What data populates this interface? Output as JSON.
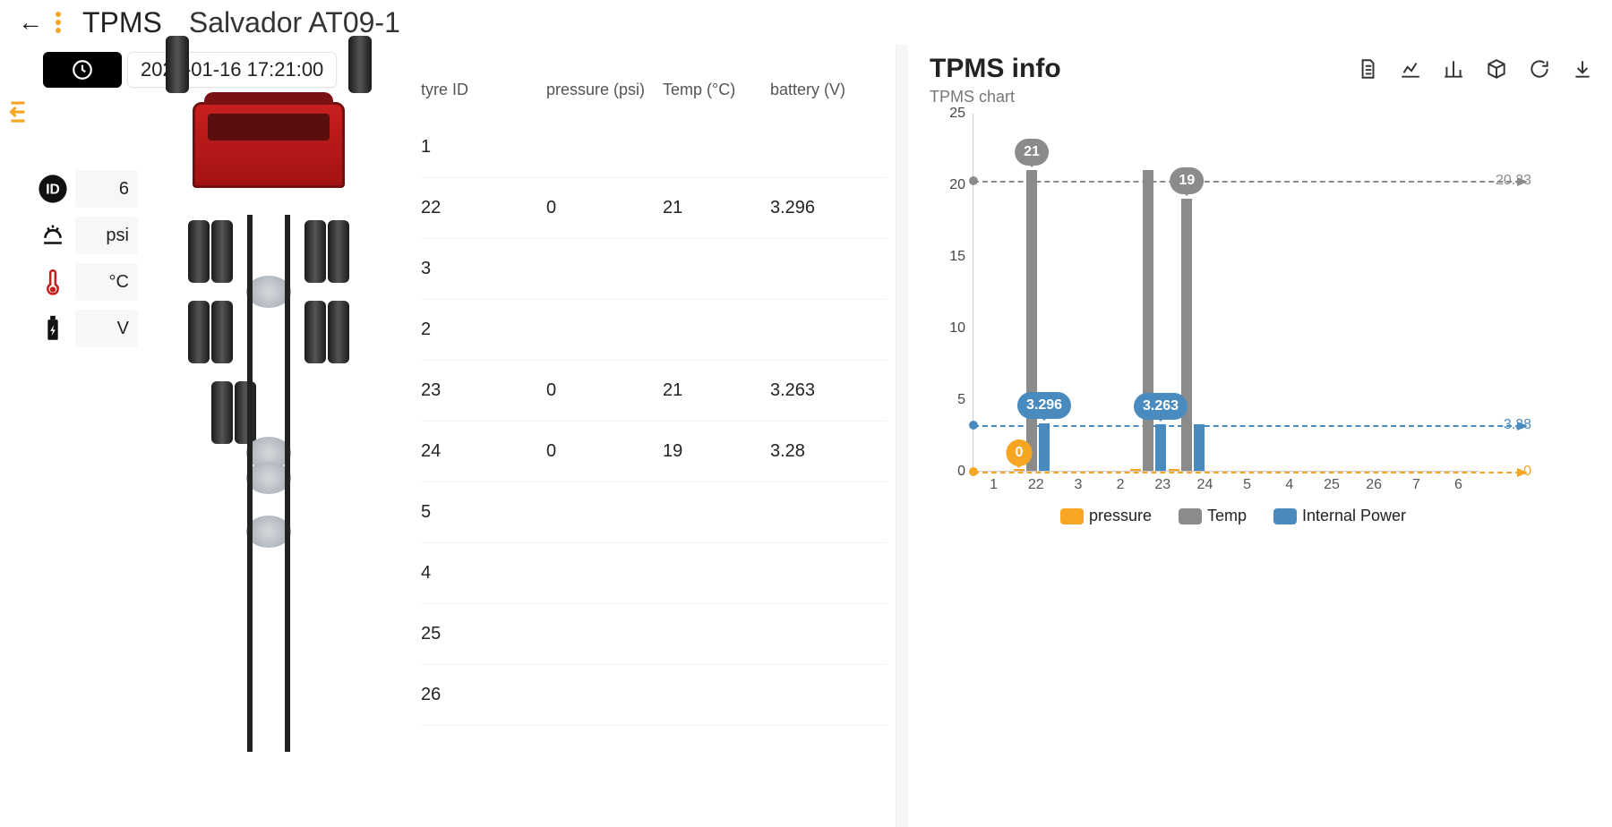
{
  "header": {
    "title": "TPMS",
    "vehicle": "Salvador AT09-1"
  },
  "timestamp": "2020-01-16 17:21:00",
  "metrics": {
    "id_value": "6",
    "pressure_unit": "psi",
    "temp_unit": "°C",
    "battery_unit": "V"
  },
  "table": {
    "head": {
      "c0": "tyre ID",
      "c1": "pressure (psi)",
      "c2": "Temp (°C)",
      "c3": "battery (V)"
    },
    "rows": [
      {
        "id": "1",
        "p": "",
        "t": "",
        "b": ""
      },
      {
        "id": "22",
        "p": "0",
        "t": "21",
        "b": "3.296"
      },
      {
        "id": "3",
        "p": "",
        "t": "",
        "b": ""
      },
      {
        "id": "2",
        "p": "",
        "t": "",
        "b": ""
      },
      {
        "id": "23",
        "p": "0",
        "t": "21",
        "b": "3.263"
      },
      {
        "id": "24",
        "p": "0",
        "t": "19",
        "b": "3.28"
      },
      {
        "id": "5",
        "p": "",
        "t": "",
        "b": ""
      },
      {
        "id": "4",
        "p": "",
        "t": "",
        "b": ""
      },
      {
        "id": "25",
        "p": "",
        "t": "",
        "b": ""
      },
      {
        "id": "26",
        "p": "",
        "t": "",
        "b": ""
      }
    ]
  },
  "right": {
    "title": "TPMS info",
    "subtitle": "TPMS chart"
  },
  "chart_data": {
    "type": "bar",
    "ylim": [
      0,
      25
    ],
    "y_ticks": [
      0,
      5,
      10,
      15,
      20,
      25
    ],
    "x_categories": [
      "1",
      "22",
      "3",
      "2",
      "23",
      "24",
      "5",
      "4",
      "25",
      "26",
      "7",
      "6"
    ],
    "series": [
      {
        "name": "pressure",
        "color": "#f6a623",
        "values": [
          null,
          0,
          null,
          null,
          0,
          0,
          null,
          null,
          null,
          null,
          null,
          null
        ]
      },
      {
        "name": "Temp",
        "color": "#8b8b8b",
        "values": [
          null,
          21,
          null,
          null,
          21,
          19,
          null,
          null,
          null,
          null,
          null,
          null
        ]
      },
      {
        "name": "Internal Power",
        "color": "#4a8bbf",
        "values": [
          null,
          3.296,
          null,
          null,
          3.263,
          3.28,
          null,
          null,
          null,
          null,
          null,
          null
        ]
      }
    ],
    "reference_lines": [
      {
        "label": "20.33",
        "value": 20.33,
        "color": "#8b8b8b"
      },
      {
        "label": "3.28",
        "value": 3.28,
        "color": "#4a8bbf"
      },
      {
        "label": "0",
        "value": 0,
        "color": "#f6a623"
      }
    ],
    "callouts": [
      {
        "x": "22",
        "value": 21,
        "series": "Temp",
        "text": "21"
      },
      {
        "x": "24",
        "value": 19,
        "series": "Temp",
        "text": "19"
      },
      {
        "x": "22",
        "value": 3.296,
        "series": "Internal Power",
        "text": "3.296"
      },
      {
        "x": "23",
        "value": 3.263,
        "series": "Internal Power",
        "text": "3.263"
      },
      {
        "x": "22",
        "value": 0,
        "series": "pressure",
        "text": "0"
      }
    ],
    "legend": {
      "l0": "pressure",
      "l1": "Temp",
      "l2": "Internal Power"
    }
  }
}
